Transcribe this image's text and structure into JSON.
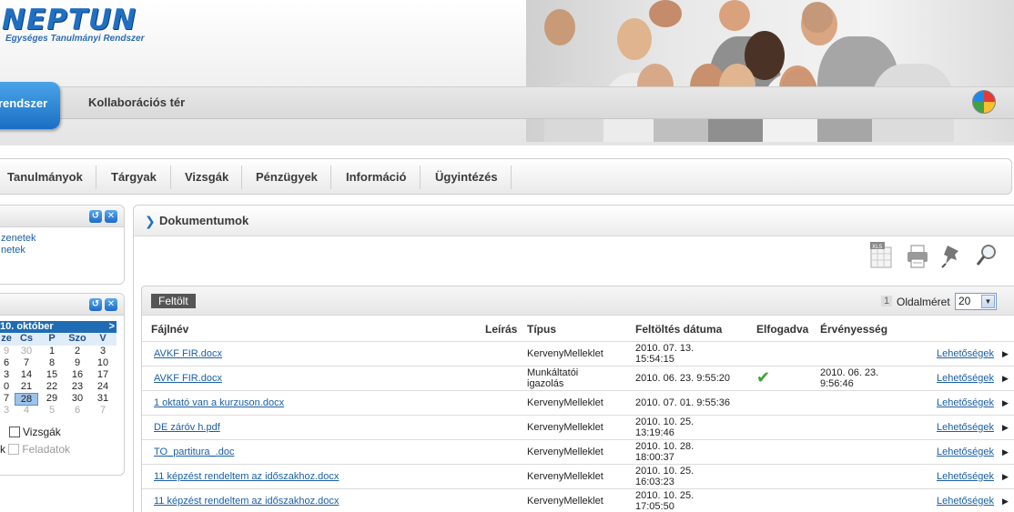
{
  "app": {
    "logo_text": "NEPTUN",
    "logo_subtitle": "Egységes Tanulmányi Rendszer"
  },
  "header_tabs": {
    "active": "rendszer",
    "collab": "Kollaborációs tér"
  },
  "nav": {
    "items": [
      "Tanulmányok",
      "Tárgyak",
      "Vizsgák",
      "Pénzügyek",
      "Információ",
      "Ügyintézés"
    ]
  },
  "messages_panel": {
    "links": [
      "zenetek",
      "netek"
    ]
  },
  "calendar": {
    "month_label": "10. október",
    "next_label": ">",
    "day_headers": [
      "ze",
      "Cs",
      "P",
      "Szo",
      "V"
    ],
    "rows": [
      [
        "9",
        "30",
        "1",
        "2",
        "3"
      ],
      [
        "6",
        "7",
        "8",
        "9",
        "10"
      ],
      [
        "3",
        "14",
        "15",
        "16",
        "17"
      ],
      [
        "0",
        "21",
        "22",
        "23",
        "24"
      ],
      [
        "7",
        "28",
        "29",
        "30",
        "31"
      ],
      [
        "3",
        "4",
        "5",
        "6",
        "7"
      ]
    ],
    "today": "28",
    "checkbox_vizsgak": "Vizsgák",
    "checkbox_feladatok_prefix": "k",
    "checkbox_feladatok": "Feladatok"
  },
  "main": {
    "title": "Dokumentumok",
    "upload_button": "Feltölt",
    "page_number": "1",
    "page_size_label": "Oldalméret",
    "page_size_value": "20",
    "columns": {
      "filename": "Fájlnév",
      "description": "Leírás",
      "type": "Típus",
      "upload_date": "Feltöltés dátuma",
      "accepted": "Elfogadva",
      "validity": "Érvényesség"
    },
    "rows": [
      {
        "file": "AVKF FIR.docx",
        "type_1": "KervenyMelleklet",
        "type_2": "",
        "date_1": "2010. 07. 13.",
        "date_2": "15:54:15",
        "accepted": false,
        "valid_1": "",
        "valid_2": "",
        "options": "Lehetőségek"
      },
      {
        "file": "AVKF FIR.docx",
        "type_1": "Munkáltatói",
        "type_2": "igazolás",
        "date_1": "2010. 06. 23. 9:55:20",
        "date_2": "",
        "accepted": true,
        "valid_1": "2010. 06. 23.",
        "valid_2": "9:56:46",
        "options": "Lehetőségek"
      },
      {
        "file": "1 oktató van a kurzuson.docx",
        "type_1": "KervenyMelleklet",
        "type_2": "",
        "date_1": "2010. 07. 01. 9:55:36",
        "date_2": "",
        "accepted": false,
        "valid_1": "",
        "valid_2": "",
        "options": "Lehetőségek"
      },
      {
        "file": "DE záróv h.pdf",
        "type_1": "KervenyMelleklet",
        "type_2": "",
        "date_1": "2010. 10. 25.",
        "date_2": "13:19:46",
        "accepted": false,
        "valid_1": "",
        "valid_2": "",
        "options": "Lehetőségek"
      },
      {
        "file": "TO_partitura_.doc",
        "type_1": "KervenyMelleklet",
        "type_2": "",
        "date_1": "2010. 10. 28.",
        "date_2": "18:00:37",
        "accepted": false,
        "valid_1": "",
        "valid_2": "",
        "options": "Lehetőségek"
      },
      {
        "file": "11 képzést rendeltem az időszakhoz.docx",
        "type_1": "KervenyMelleklet",
        "type_2": "",
        "date_1": "2010. 10. 25.",
        "date_2": "16:03:23",
        "accepted": false,
        "valid_1": "",
        "valid_2": "",
        "options": "Lehetőségek"
      },
      {
        "file": "11 képzést rendeltem az időszakhoz.docx",
        "type_1": "KervenyMelleklet",
        "type_2": "",
        "date_1": "2010. 10. 25.",
        "date_2": "17:05:50",
        "accepted": false,
        "valid_1": "",
        "valid_2": "",
        "options": "Lehetőségek"
      }
    ]
  },
  "icons": {
    "toolbar": [
      "excel-export-icon",
      "print-icon",
      "pin-icon",
      "search-icon"
    ],
    "accent_blue": "#1f6fc2",
    "accept_green": "#3aa03a"
  }
}
